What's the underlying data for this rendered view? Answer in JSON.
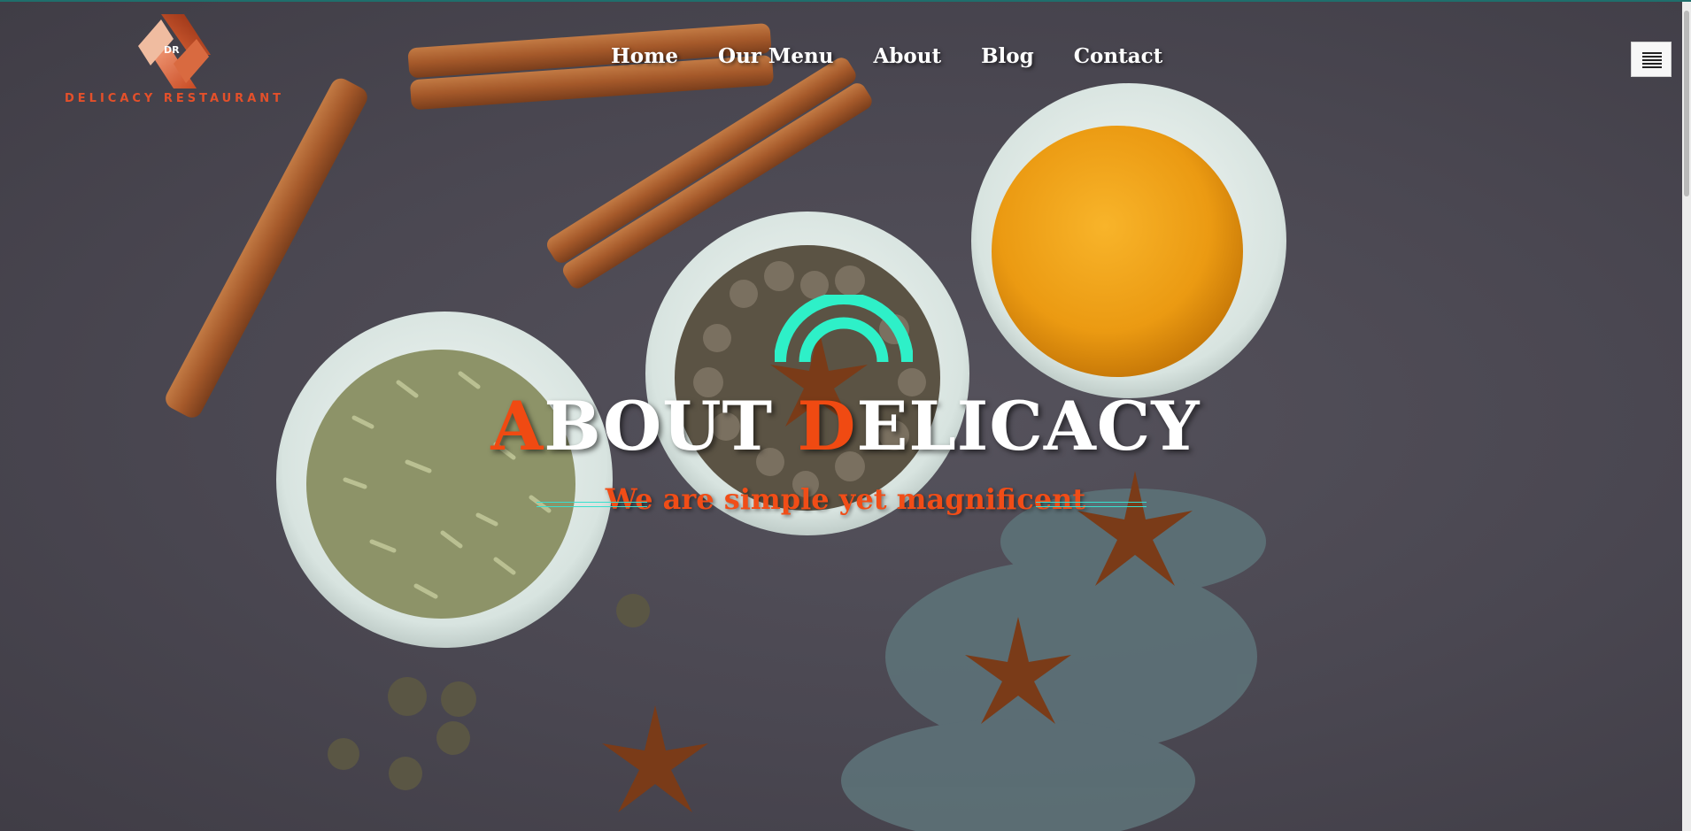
{
  "brand": {
    "name": "DELICACY RESTAURANT",
    "monogram": "DR"
  },
  "nav": {
    "items": [
      {
        "label": "Home"
      },
      {
        "label": "Our Menu"
      },
      {
        "label": "About"
      },
      {
        "label": "Blog"
      },
      {
        "label": "Contact"
      }
    ]
  },
  "hero": {
    "title_first_initial": "A",
    "title_first_rest": "BOUT ",
    "title_second_initial": "D",
    "title_second_rest": "ELICACY",
    "subtitle": "We are simple yet magnificent"
  },
  "icons": {
    "menu": "hamburger-menu-icon",
    "arc": "signal-arc-icon"
  },
  "colors": {
    "accent": "#f04a12",
    "teal": "#2ef0c8",
    "line": "#38e0cf",
    "background": "#4a4750"
  }
}
